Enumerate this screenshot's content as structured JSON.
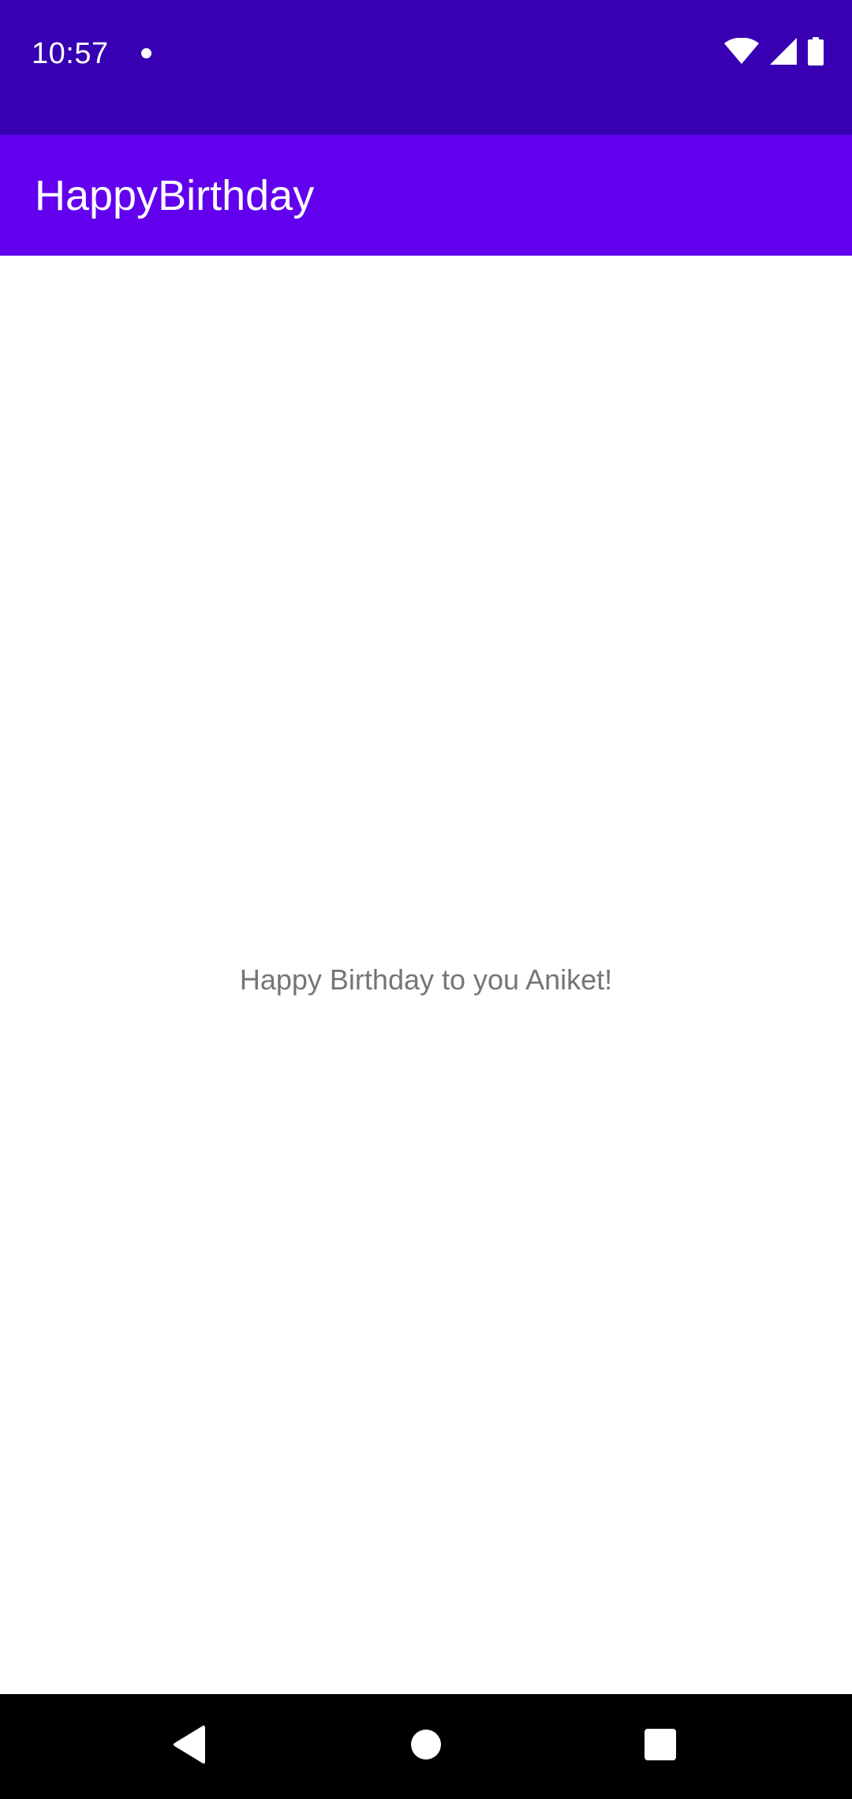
{
  "status_bar": {
    "time": "10:57",
    "icons": [
      "notification-dot-icon",
      "wifi-icon",
      "cell-signal-icon",
      "battery-icon"
    ],
    "background": "#3700b3"
  },
  "app_bar": {
    "title": "HappyBirthday",
    "background": "#6200ee"
  },
  "main": {
    "greeting": "Happy Birthday to you Aniket!"
  },
  "nav_bar": {
    "buttons": [
      "back-icon",
      "home-icon",
      "recents-icon"
    ],
    "background": "#000000"
  }
}
